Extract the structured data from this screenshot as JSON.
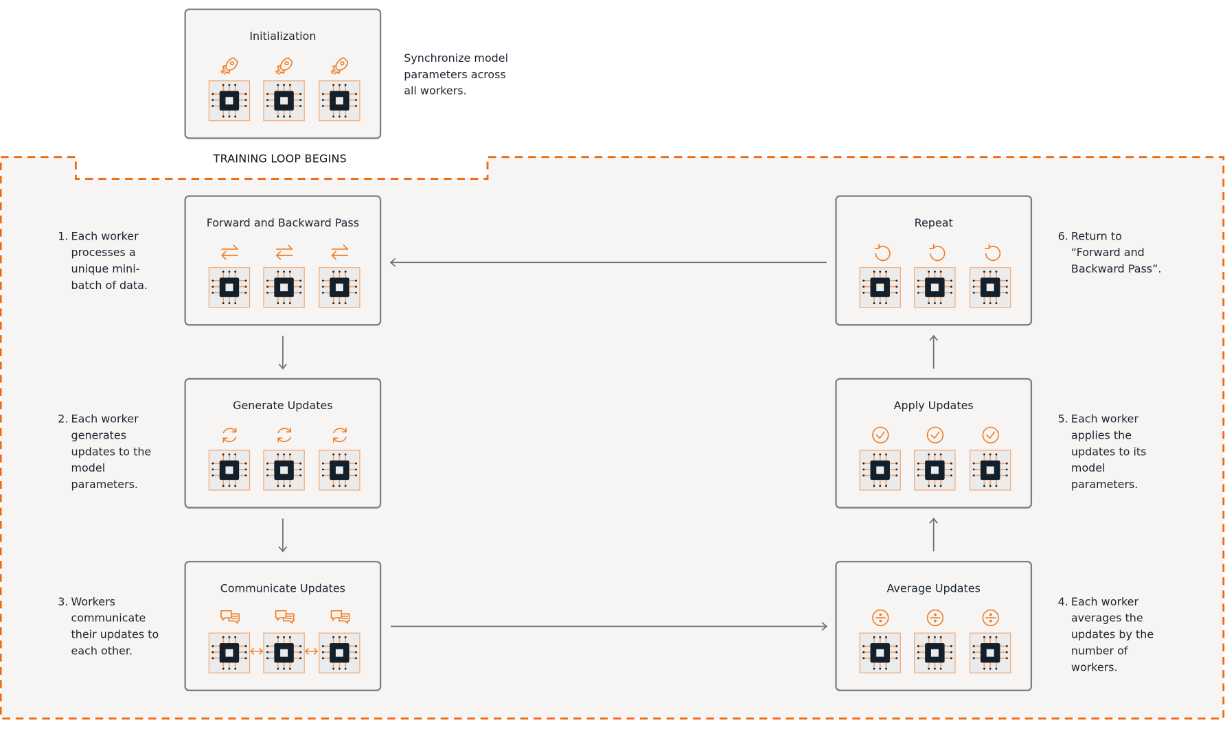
{
  "colors": {
    "accent": "#f07b22",
    "dashed_border": "#ef6a13",
    "box_border": "#7d7d7d",
    "chip_dark": "#13202b",
    "region_bg": "#f6f5f3"
  },
  "init": {
    "title": "Initialization",
    "icon": "rocket-icon",
    "description": "Synchronize model\nparameters across\nall workers."
  },
  "loop_label": "TRAINING LOOP BEGINS",
  "boxes": [
    {
      "id": "forward-backward",
      "title": "Forward and Backward Pass",
      "icon": "swap-arrows-icon",
      "step_num": "1.",
      "step_text": "Each worker\nprocesses a\nunique mini-\nbatch of data."
    },
    {
      "id": "generate-updates",
      "title": "Generate Updates",
      "icon": "refresh-icon",
      "step_num": "2.",
      "step_text": "Each worker\ngenerates\nupdates to the\nmodel\nparameters."
    },
    {
      "id": "communicate-updates",
      "title": "Communicate Updates",
      "icon": "chat-icon",
      "step_num": "3.",
      "step_text": "Workers\ncommunicate\ntheir updates to\neach other."
    },
    {
      "id": "average-updates",
      "title": "Average Updates",
      "icon": "divide-icon",
      "step_num": "4.",
      "step_text": "Each worker\naverages the\nupdates by the\nnumber of\nworkers."
    },
    {
      "id": "apply-updates",
      "title": "Apply Updates",
      "icon": "check-circle-icon",
      "step_num": "5.",
      "step_text": "Each worker\napplies the\nupdates to its\nmodel\nparameters."
    },
    {
      "id": "repeat",
      "title": "Repeat",
      "icon": "rotate-left-icon",
      "step_num": "6.",
      "step_text": "Return to\n“Forward and\nBackward Pass”."
    }
  ]
}
